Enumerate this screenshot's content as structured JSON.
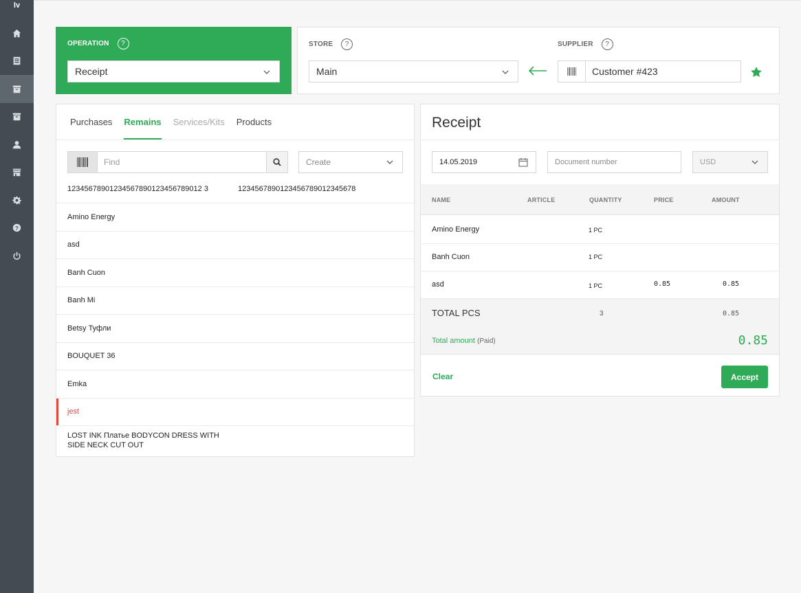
{
  "app": {
    "logo": "lv"
  },
  "sidebar": {
    "items": [
      {
        "icon": "home-icon"
      },
      {
        "icon": "list-icon"
      },
      {
        "icon": "archive-icon",
        "active": true
      },
      {
        "icon": "archive-icon"
      },
      {
        "icon": "user-icon"
      },
      {
        "icon": "store-icon"
      },
      {
        "icon": "gear-icon"
      },
      {
        "icon": "help-icon"
      },
      {
        "icon": "power-icon"
      }
    ]
  },
  "operation": {
    "label": "OPERATION",
    "value": "Receipt"
  },
  "store": {
    "label": "STORE",
    "value": "Main"
  },
  "supplier": {
    "label": "SUPPLIER",
    "value": "Customer #423"
  },
  "left": {
    "tabs": [
      "Purchases",
      "Remains",
      "Services/Kits",
      "Products"
    ],
    "active_tab": "Remains",
    "find_placeholder": "Find",
    "create_label": "Create",
    "codes": [
      "12345678901234567890123456789012 3",
      "1234567890123456789012345678"
    ],
    "products": [
      "Amino Energy",
      "asd",
      "Banh Cuon",
      "Banh Mi",
      "Betsy Туфли",
      "BOUQUET 36",
      "Emka",
      "jest",
      "LOST INK Платье BODYCON DRESS WITH",
      "SIDE NECK CUT OUT"
    ]
  },
  "receipt": {
    "title": "Receipt",
    "date": "14.05.2019",
    "doc_placeholder": "Document number",
    "currency": "USD",
    "columns": [
      "NAME",
      "ARTICLE",
      "QUANTITY",
      "PRICE",
      "AMOUNT"
    ],
    "rows": [
      {
        "name": "Amino Energy",
        "article": "",
        "quantity": "1 PC",
        "price": "",
        "amount": ""
      },
      {
        "name": "Banh Cuon",
        "article": "",
        "quantity": "1 PC",
        "price": "",
        "amount": ""
      },
      {
        "name": "asd",
        "article": "",
        "quantity": "1 PC",
        "price": "0.85",
        "amount": "0.85"
      }
    ],
    "total_label": "TOTAL PCS",
    "total_qty": "3",
    "total_amount_sum": "0.85",
    "total_amount_label": "Total amount",
    "total_amount_status": "(Paid)",
    "total_amount_value": "0.85",
    "clear_label": "Clear",
    "accept_label": "Accept"
  },
  "colors": {
    "accent": "#2faa56",
    "sidebar": "#444b52",
    "error": "#e2473f"
  }
}
